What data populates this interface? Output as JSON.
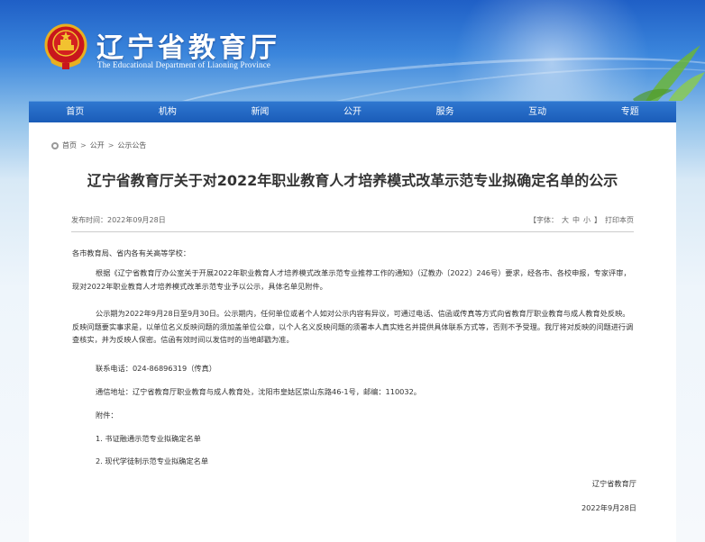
{
  "header": {
    "title": "辽宁省教育厅",
    "subtitle": "The Educational Department of Liaoning Province",
    "emblem_icon": "national-emblem-icon"
  },
  "nav": {
    "items": [
      {
        "label": "首页"
      },
      {
        "label": "机构"
      },
      {
        "label": "新闻"
      },
      {
        "label": "公开"
      },
      {
        "label": "服务"
      },
      {
        "label": "互动"
      },
      {
        "label": "专题"
      }
    ]
  },
  "breadcrumb": {
    "items": [
      "首页",
      "公开",
      "公示公告"
    ],
    "separator": ">"
  },
  "article": {
    "title": "辽宁省教育厅关于对2022年职业教育人才培养模式改革示范专业拟确定名单的公示",
    "publish_time": "发布时间：2022年09月28日",
    "font_label": "【字体：",
    "font_large": "大",
    "font_medium": "中",
    "font_small": "小",
    "font_close": "】",
    "print_label": "打印本页",
    "greeting": "各市教育局、省内各有关高等学校：",
    "para1": "根据《辽宁省教育厅办公室关于开展2022年职业教育人才培养模式改革示范专业推荐工作的通知》（辽教办〔2022〕246号）要求，经各市、各校申报，专家评审，现对2022年职业教育人才培养模式改革示范专业予以公示，具体名单见附件。",
    "para2": "公示期为2022年9月28日至9月30日。公示期内，任何单位或者个人如对公示内容有异议，可通过电话、信函或传真等方式向省教育厅职业教育与成人教育处反映。反映问题要实事求是，以单位名义反映问题的须加盖单位公章，以个人名义反映问题的须署本人真实姓名并提供具体联系方式等，否则不予受理。我厅将对反映的问题进行调查核实，并为反映人保密。信函有效时间以发信时的当地邮戳为准。",
    "phone": "联系电话：024-86896319（传真）",
    "address": "通信地址：辽宁省教育厅职业教育与成人教育处，沈阳市皇姑区崇山东路46-1号，邮编：110032。",
    "attachments_label": "附件：",
    "attachment1": "1. 书证融通示范专业拟确定名单",
    "attachment2": "2. 现代学徒制示范专业拟确定名单",
    "signature": "辽宁省教育厅",
    "date": "2022年9月28日"
  }
}
